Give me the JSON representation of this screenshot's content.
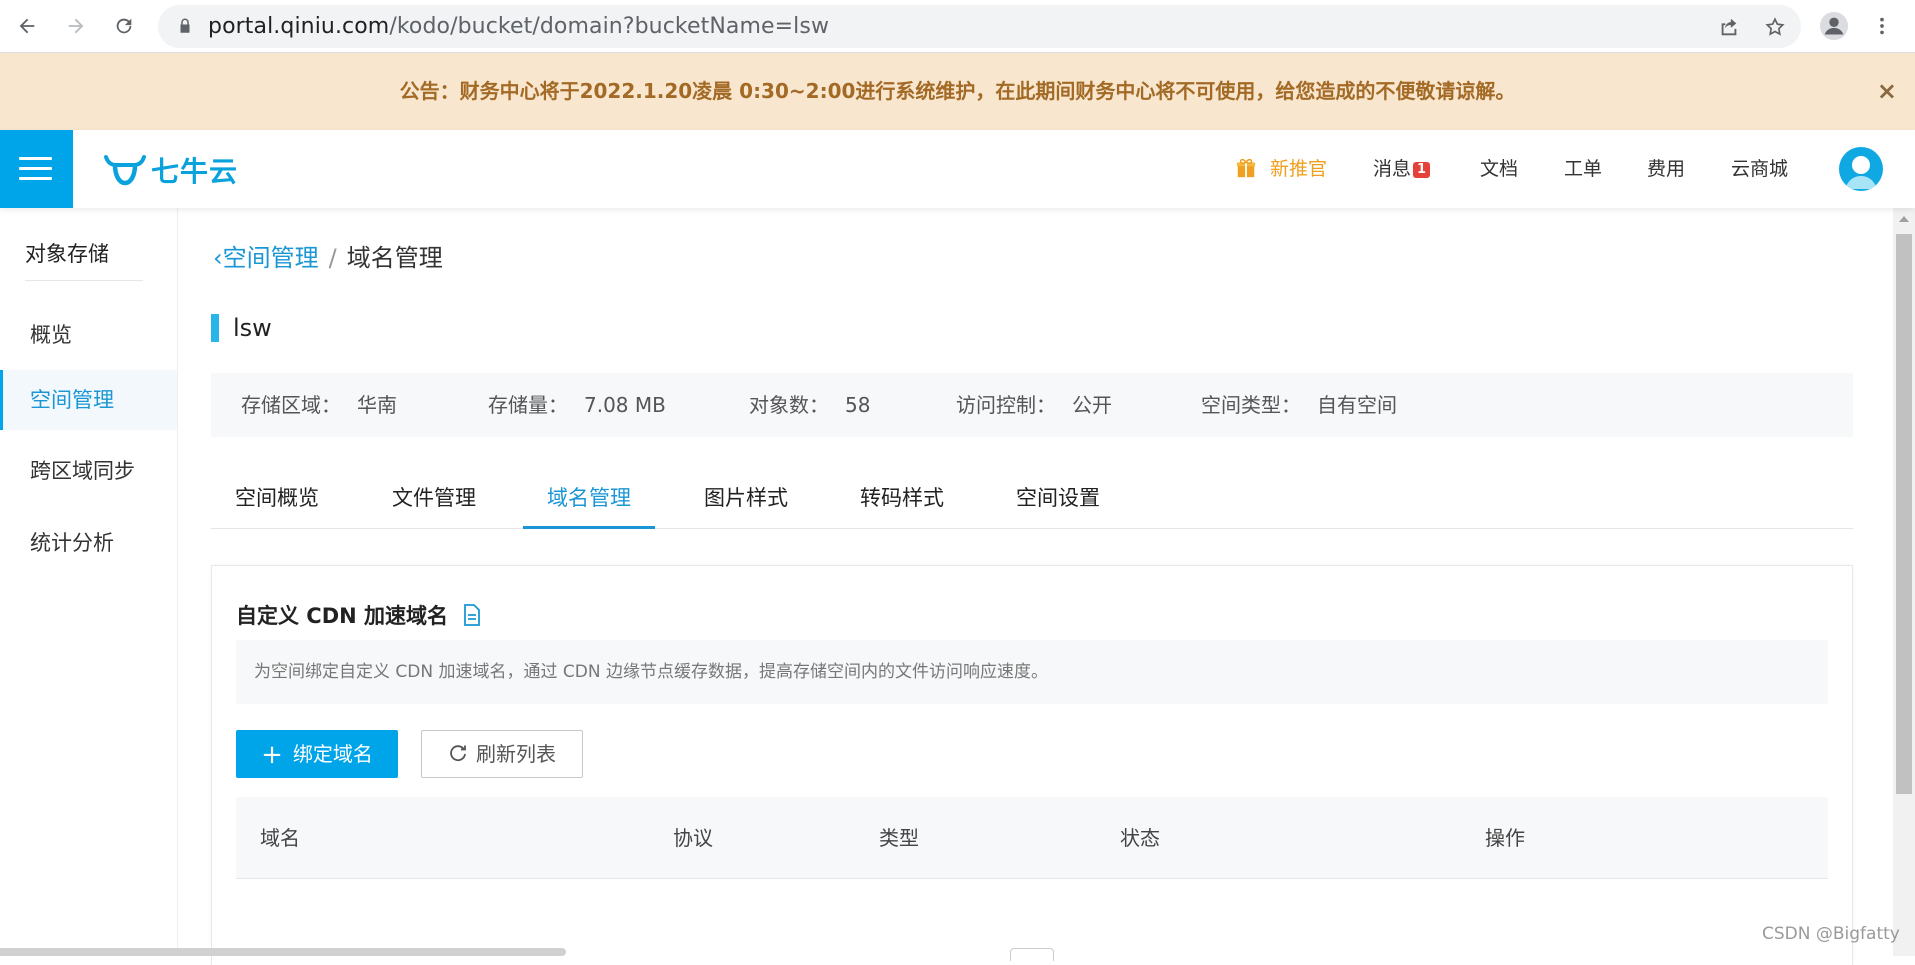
{
  "browser": {
    "url_host": "portal.qiniu.com",
    "url_path": "/kodo/bucket/domain?bucketName=lsw"
  },
  "announcement": {
    "text": "公告：财务中心将于2022.1.20凌晨 0:30~2:00进行系统维护，在此期间财务中心将不可使用，给您造成的不便敬请谅解。",
    "close": "×"
  },
  "topnav": {
    "logo_text": "七牛云",
    "promo": "新推官",
    "messages": "消息",
    "messages_badge": "1",
    "docs": "文档",
    "tickets": "工单",
    "billing": "费用",
    "marketplace": "云商城"
  },
  "sidebar": {
    "title": "对象存储",
    "items": [
      {
        "label": "概览"
      },
      {
        "label": "空间管理"
      },
      {
        "label": "跨区域同步"
      },
      {
        "label": "统计分析"
      }
    ]
  },
  "breadcrumb": {
    "back": "空间管理",
    "separator": "/",
    "current": "域名管理"
  },
  "bucket": {
    "name": "lsw",
    "region_label": "存储区域：",
    "region": "华南",
    "storage_label": "存储量：",
    "storage": "7.08 MB",
    "objects_label": "对象数：",
    "objects": "58",
    "access_label": "访问控制：",
    "access": "公开",
    "type_label": "空间类型：",
    "type": "自有空间"
  },
  "tabs": [
    {
      "label": "空间概览"
    },
    {
      "label": "文件管理"
    },
    {
      "label": "域名管理"
    },
    {
      "label": "图片样式"
    },
    {
      "label": "转码样式"
    },
    {
      "label": "空间设置"
    }
  ],
  "panel": {
    "title": "自定义 CDN 加速域名",
    "hint": "为空间绑定自定义 CDN 加速域名，通过 CDN 边缘节点缓存数据，提高存储空间内的文件访问响应速度。",
    "bind_button": "绑定域名",
    "refresh_button": "刷新列表",
    "columns": [
      "域名",
      "协议",
      "类型",
      "状态",
      "操作"
    ]
  },
  "watermark": "CSDN @Bigfatty",
  "colors": {
    "accent": "#00a4e8",
    "link": "#1a96d4",
    "announce_bg": "#f8e6cf",
    "announce_text": "#a36a25",
    "promo": "#f0a020",
    "badge": "#e5403a"
  }
}
